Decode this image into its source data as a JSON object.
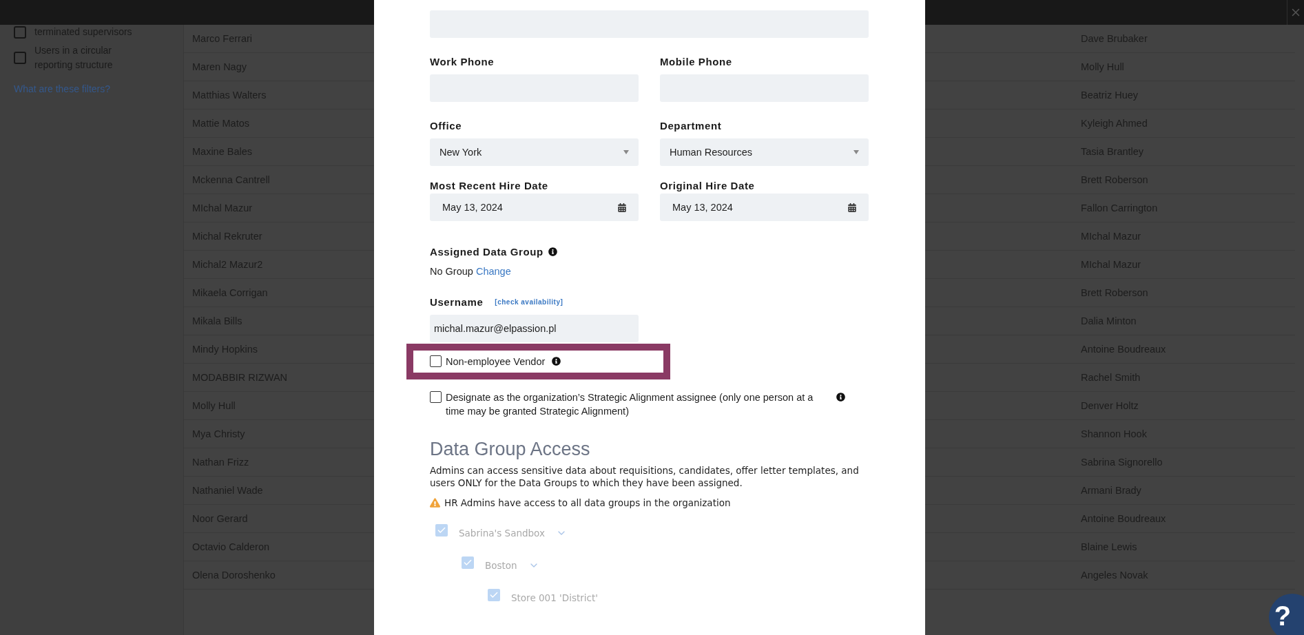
{
  "sidebar": {
    "filters": [
      {
        "label": "terminated supervisors",
        "checked": false
      },
      {
        "label": "Users in a circular reporting structure",
        "checked": false
      }
    ],
    "help_link": "What are these filters?"
  },
  "table": {
    "rows": [
      {
        "name": "Marco Ferrari",
        "column_2": "Dave Brubaker"
      },
      {
        "name": "Maren Nagy",
        "column_2": "Molly Hull"
      },
      {
        "name": "Matthias Walters",
        "column_2": "Beatriz Huey"
      },
      {
        "name": "Mattie Matos",
        "column_2": "Kyleigh Ahmed"
      },
      {
        "name": "Maxine Bales",
        "column_2": "Tasia Brantley"
      },
      {
        "name": "Mckenna Cantrell",
        "column_2": "Brett Roberson"
      },
      {
        "name": "MIchal Mazur",
        "column_2": "Fallon Carrington"
      },
      {
        "name": "Michal Rekruter",
        "column_2": "MIchal Mazur"
      },
      {
        "name": "Michal2 Mazur2",
        "column_2": "MIchal Mazur"
      },
      {
        "name": "Mikaela Corrigan",
        "column_2": "Brett Roberson"
      },
      {
        "name": "Mikala Bills",
        "column_2": "Dalia Minton"
      },
      {
        "name": "Mindy Hopkins",
        "column_2": "Antoine Boudreaux"
      },
      {
        "name": "MODABBIR RIZWAN",
        "column_2": "Rachel Smith"
      },
      {
        "name": "Molly Hull",
        "column_2": "Denver Holtz"
      },
      {
        "name": "Mya Christy",
        "column_2": "Shannon Hook"
      },
      {
        "name": "Nathan Frizz",
        "column_2": "Sabrina Signorello"
      },
      {
        "name": "Nathaniel Wade",
        "column_2": "Armani Brady"
      },
      {
        "name": "Noor Gerard",
        "column_2": "Antoine Boudreaux"
      },
      {
        "name": "Octavio Calderon",
        "column_2": "Blaine Lewis"
      },
      {
        "name": "Olena Doroshenko",
        "column_2": "Angeles Novak"
      }
    ]
  },
  "help_button": "?",
  "modal": {
    "field_rows": [
      [
        {
          "label": "Work Phone",
          "kind": "text"
        },
        {
          "label": "Mobile Phone",
          "kind": "text"
        }
      ],
      [
        {
          "label": "Office",
          "kind": "select",
          "value": "New York"
        },
        {
          "label": "Department",
          "kind": "select",
          "value": "Human Resources"
        }
      ],
      [
        {
          "label": "Most Recent Hire Date",
          "kind": "date",
          "value": "May 13, 2024"
        },
        {
          "label": "Original Hire Date",
          "kind": "date",
          "value": "May 13, 2024"
        }
      ]
    ],
    "assigned_group": {
      "label": "Assigned Data Group",
      "value": "No Group",
      "link": "Change"
    },
    "username": {
      "label": "Username",
      "link": "[check availability]",
      "value": "michal.mazur@elpassion.pl"
    },
    "checkboxes": [
      {
        "label": "Non-employee Vendor",
        "checked": false,
        "highlighted": true
      },
      {
        "label": "Designate as the organization’s Strategic Alignment assignee (only one person at a time may be granted Strategic Alignment)",
        "checked": false,
        "highlighted": false
      }
    ],
    "data_group_access": {
      "title": "Data Group Access",
      "description": "Admins can access sensitive data about requisitions, candidates, offer letter templates, and users ONLY for the Data Groups to which they have been assigned.",
      "warning": "HR Admins have access to all data groups in the organization",
      "tree": [
        {
          "label": "Sabrina's Sandbox",
          "checked": true,
          "disabled": true,
          "expanded": true,
          "children": [
            {
              "label": "Boston",
              "checked": true,
              "disabled": true,
              "expanded": true,
              "children": [
                {
                  "label": "Store 001 'District'",
                  "checked": true,
                  "disabled": true
                }
              ]
            }
          ]
        }
      ]
    }
  }
}
